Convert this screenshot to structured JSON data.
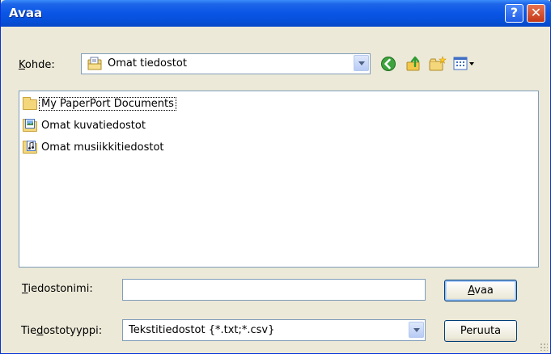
{
  "window": {
    "title": "Avaa",
    "help_label": "?",
    "close_label": "✕"
  },
  "location": {
    "label_prefix": "",
    "label_accel": "K",
    "label_rest": "ohde:",
    "value": "Omat tiedostot"
  },
  "toolbar": {
    "icons": [
      "back-icon",
      "up-folder-icon",
      "new-folder-icon",
      "views-menu-icon"
    ]
  },
  "files": [
    {
      "name": "My PaperPort Documents",
      "icon": "folder-icon",
      "selected": true
    },
    {
      "name": "Omat kuvatiedostot",
      "icon": "pictures-folder-icon",
      "selected": false
    },
    {
      "name": "Omat musiikkitiedostot",
      "icon": "music-folder-icon",
      "selected": false
    }
  ],
  "filename": {
    "label_accel": "T",
    "label_rest": "iedostonimi:",
    "value": ""
  },
  "filetype": {
    "label_prefix": "Tie",
    "label_accel": "d",
    "label_rest": "ostotyyppi:",
    "value": "Tekstitiedostot {*.txt;*.csv}"
  },
  "buttons": {
    "open_accel": "A",
    "open_rest": "vaa",
    "cancel": "Peruuta"
  },
  "colors": {
    "titlebar": "#0a55e6",
    "face": "#ece9d8",
    "border": "#7f9db9"
  }
}
